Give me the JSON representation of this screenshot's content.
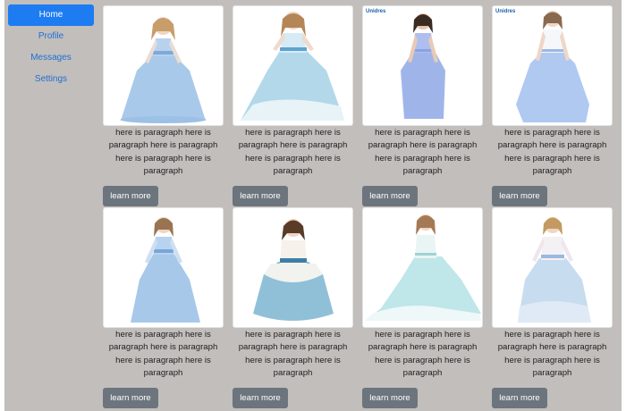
{
  "sidebar": {
    "items": [
      {
        "label": "Home",
        "active": true
      },
      {
        "label": "Profile",
        "active": false
      },
      {
        "label": "Messages",
        "active": false
      },
      {
        "label": "Settings",
        "active": false
      }
    ]
  },
  "cards": [
    {
      "image": "girl-blue-gown-lace-sleeves",
      "caption": "here is paragraph here is paragraph here is paragraph here is paragraph here is paragraph",
      "button": "learn more"
    },
    {
      "image": "girl-blue-gown-lace-train",
      "caption": "here is paragraph here is paragraph here is paragraph here is paragraph here is paragraph",
      "button": "learn more"
    },
    {
      "image": "girl-periwinkle-halter-gown",
      "caption": "here is paragraph here is paragraph here is paragraph here is paragraph here is paragraph",
      "button": "learn more",
      "logo": "Unidres"
    },
    {
      "image": "girl-blue-satin-gown",
      "caption": "here is paragraph here is paragraph here is paragraph here is paragraph here is paragraph",
      "button": "learn more",
      "logo": "Unidres"
    },
    {
      "image": "girl-blue-tulle-gown-sleeves",
      "caption": "here is paragraph here is paragraph here is paragraph here is paragraph here is paragraph",
      "button": "learn more"
    },
    {
      "image": "girl-aqua-ballgown",
      "caption": "here is paragraph here is paragraph here is paragraph here is paragraph here is paragraph",
      "button": "learn more"
    },
    {
      "image": "girl-mint-lace-gown",
      "caption": "here is paragraph here is paragraph here is paragraph here is paragraph here is paragraph",
      "button": "learn more"
    },
    {
      "image": "girl-pale-blue-gown-sleeves",
      "caption": "here is paragraph here is paragraph here is paragraph here is paragraph here is paragraph",
      "button": "learn more"
    }
  ],
  "colors": {
    "background": "#c2bebb",
    "nav_active": "#1e7cf2",
    "nav_link": "#1f6fd6",
    "button": "#6c757d"
  }
}
